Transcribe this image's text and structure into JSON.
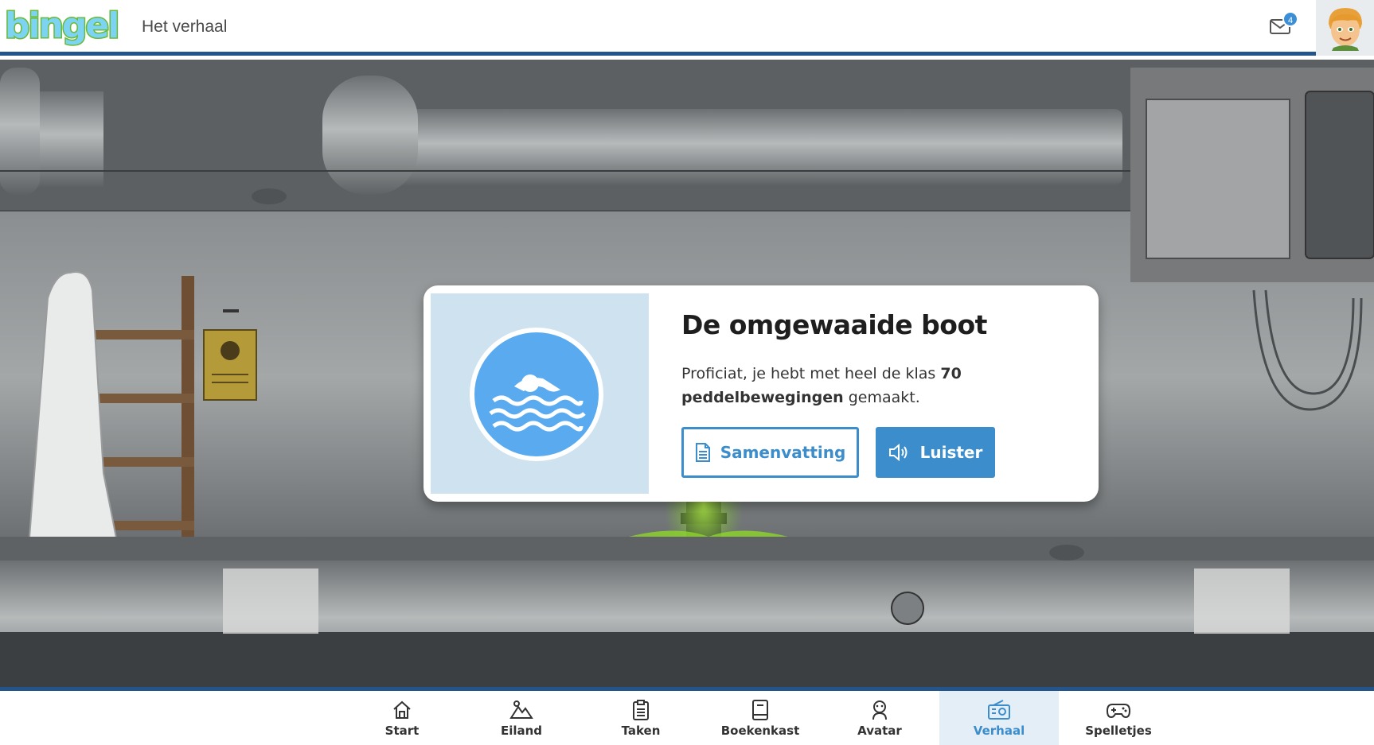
{
  "header": {
    "logo_text": "bingel",
    "page_title": "Het verhaal",
    "mail_icon": "envelope-icon",
    "mail_count": "4",
    "avatar": "avatar-icon"
  },
  "story_card": {
    "image_icon": "swimmer-icon",
    "title": "De omgewaaide boot",
    "text_before": "Proficiat, je hebt met heel de klas ",
    "text_bold": "70 peddelbewegingen",
    "text_after": " gemaakt.",
    "summary_button": "Samenvatting",
    "listen_button": "Luister"
  },
  "bottom_nav": {
    "items": [
      {
        "label": "Start",
        "icon": "home-icon"
      },
      {
        "label": "Eiland",
        "icon": "mountain-icon"
      },
      {
        "label": "Taken",
        "icon": "clipboard-icon"
      },
      {
        "label": "Boekenkast",
        "icon": "book-icon"
      },
      {
        "label": "Avatar",
        "icon": "person-icon"
      },
      {
        "label": "Verhaal",
        "icon": "radio-icon"
      },
      {
        "label": "Spelletjes",
        "icon": "gamepad-icon"
      }
    ],
    "active": "Verhaal"
  },
  "colors": {
    "accent": "#3c8dcc",
    "header_border": "#23558c",
    "card_image_bg": "#cfe2f0"
  }
}
